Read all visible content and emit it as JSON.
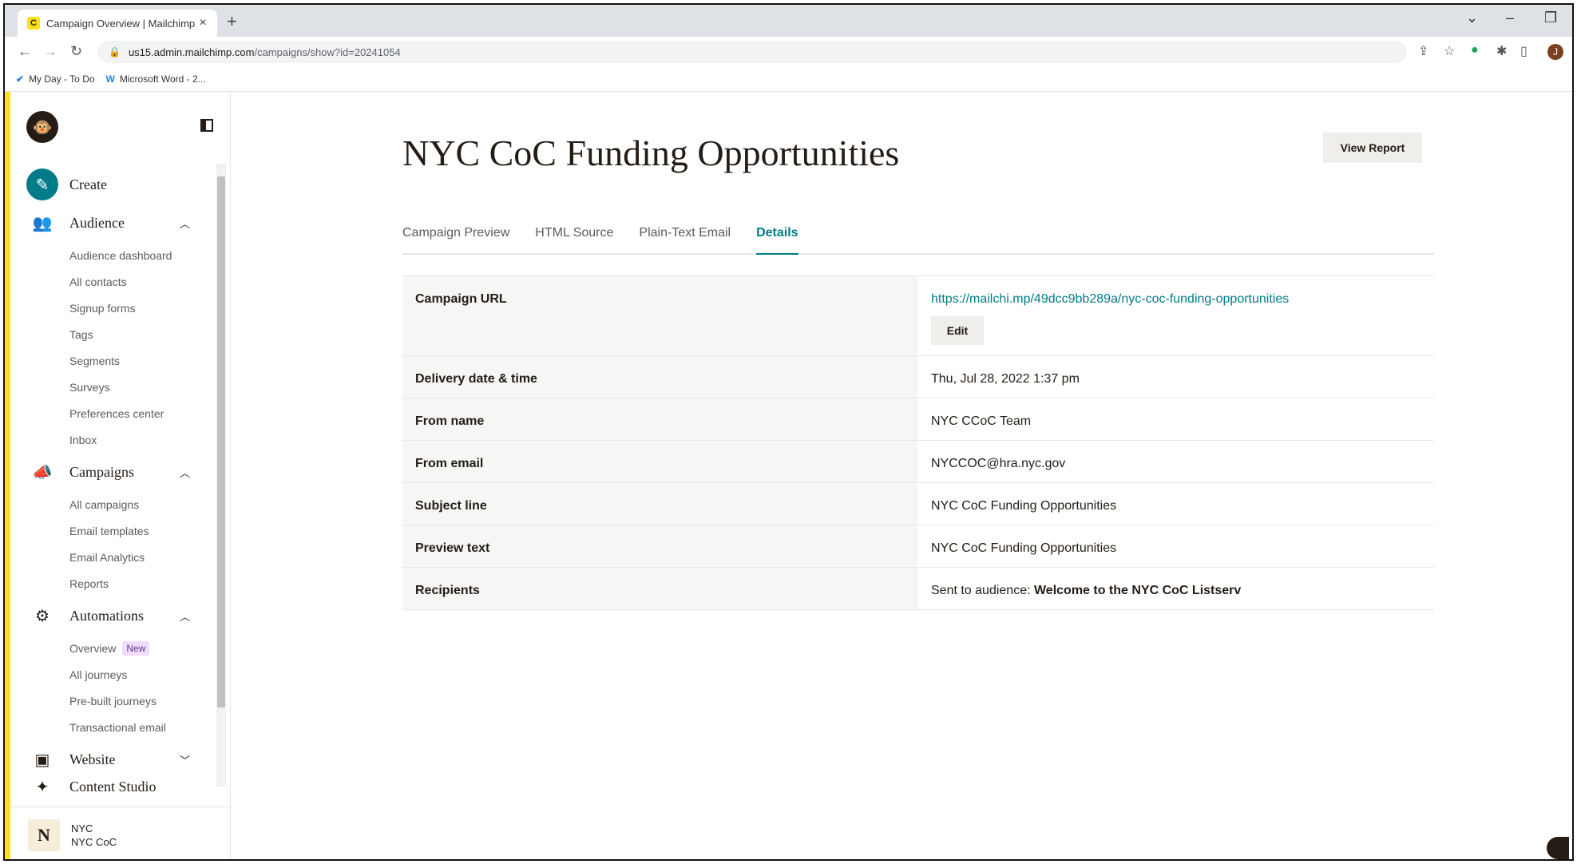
{
  "browser": {
    "tab_title": "Campaign Overview | Mailchimp",
    "tab_close": "×",
    "new_tab": "+",
    "url_host": "us15.admin.mailchimp.com",
    "url_path": "/campaigns/show?id=20241054",
    "bookmarks": [
      {
        "label": "My Day - To Do",
        "icon": "checkmark-icon"
      },
      {
        "label": "Microsoft Word - 2...",
        "icon": "word-icon"
      }
    ],
    "profile_initial": "J"
  },
  "sidebar": {
    "create": "Create",
    "audience": {
      "label": "Audience",
      "items": [
        "Audience dashboard",
        "All contacts",
        "Signup forms",
        "Tags",
        "Segments",
        "Surveys",
        "Preferences center",
        "Inbox"
      ]
    },
    "campaigns": {
      "label": "Campaigns",
      "items": [
        "All campaigns",
        "Email templates",
        "Email Analytics",
        "Reports"
      ]
    },
    "automations": {
      "label": "Automations",
      "items": [
        "Overview",
        "All journeys",
        "Pre-built journeys",
        "Transactional email"
      ],
      "badge": "New"
    },
    "website": "Website",
    "content_studio": "Content Studio",
    "account": {
      "avatar": "N",
      "name": "NYC",
      "org": "NYC CoC"
    }
  },
  "main": {
    "title": "NYC CoC Funding Opportunities",
    "view_report": "View Report",
    "tabs": [
      "Campaign Preview",
      "HTML Source",
      "Plain-Text Email",
      "Details"
    ],
    "active_tab": "Details",
    "details": {
      "campaign_url_label": "Campaign URL",
      "campaign_url": "https://mailchi.mp/49dcc9bb289a/nyc-coc-funding-opportunities",
      "edit": "Edit",
      "rows": [
        {
          "label": "Delivery date & time",
          "value": "Thu, Jul 28, 2022 1:37 pm"
        },
        {
          "label": "From name",
          "value": "NYC CCoC Team"
        },
        {
          "label": "From email",
          "value": "NYCCOC@hra.nyc.gov"
        },
        {
          "label": "Subject line",
          "value": "NYC CoC Funding Opportunities"
        },
        {
          "label": "Preview text",
          "value": "NYC CoC Funding Opportunities"
        }
      ],
      "recipients_label": "Recipients",
      "recipients_prefix": "Sent to audience: ",
      "recipients_audience": "Welcome to the NYC CoC Listserv"
    }
  }
}
